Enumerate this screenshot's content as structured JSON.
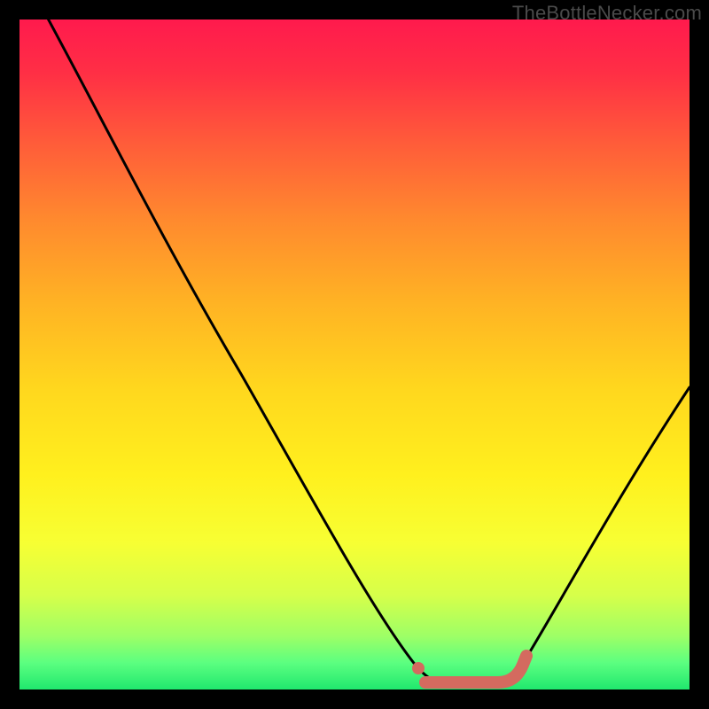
{
  "attribution": "TheBottleNecker.com",
  "colors": {
    "frame": "#000000",
    "curve": "#000000",
    "marker": "#d46a5f",
    "gradient_top": "#ff1a4d",
    "gradient_bottom": "#20e86e"
  },
  "chart_data": {
    "type": "line",
    "title": "",
    "xlabel": "",
    "ylabel": "",
    "xlim": [
      0,
      100
    ],
    "ylim": [
      0,
      100
    ],
    "series": [
      {
        "name": "bottleneck-curve",
        "x": [
          0,
          5,
          10,
          15,
          20,
          25,
          30,
          35,
          40,
          45,
          50,
          55,
          58,
          60,
          62,
          65,
          70,
          73,
          75,
          80,
          85,
          90,
          95,
          100
        ],
        "values": [
          108,
          100,
          90,
          80,
          70,
          60,
          50,
          41,
          32,
          23,
          15,
          8,
          4,
          2,
          1,
          0,
          0,
          1,
          3,
          10,
          18,
          27,
          36,
          45
        ]
      }
    ],
    "markers": [
      {
        "name": "optimal-start-dot",
        "x": 60,
        "y": 2,
        "shape": "circle"
      },
      {
        "name": "optimal-range-bar",
        "x_start": 61,
        "x_end": 74,
        "y": 1,
        "shape": "rounded-segment"
      }
    ],
    "annotations": []
  }
}
